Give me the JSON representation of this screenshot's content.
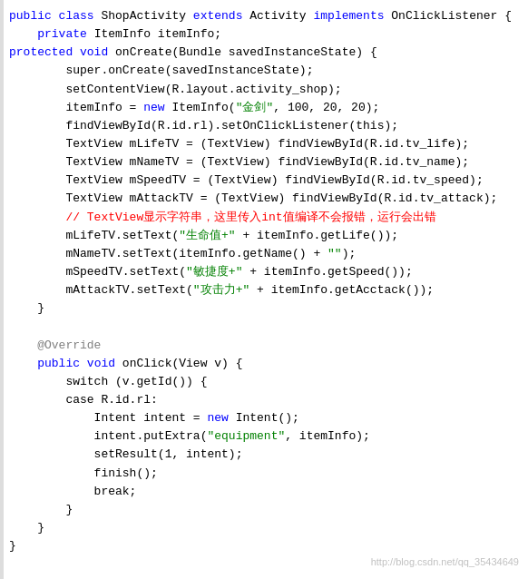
{
  "code": {
    "lines": [
      {
        "tokens": [
          {
            "text": "public class ",
            "style": "kw"
          },
          {
            "text": "ShopActivity ",
            "style": "id"
          },
          {
            "text": "extends ",
            "style": "kw"
          },
          {
            "text": "Activity ",
            "style": "id"
          },
          {
            "text": "implements ",
            "style": "kw"
          },
          {
            "text": "OnClickListener {",
            "style": "id"
          }
        ]
      },
      {
        "tokens": [
          {
            "text": "    private ",
            "style": "kw"
          },
          {
            "text": "ItemInfo itemInfo;",
            "style": "id"
          }
        ]
      },
      {
        "tokens": [
          {
            "text": "protected ",
            "style": "kw"
          },
          {
            "text": "void ",
            "style": "kw"
          },
          {
            "text": "onCreate(Bundle savedInstanceState) {",
            "style": "id"
          }
        ]
      },
      {
        "tokens": [
          {
            "text": "        super.onCreate(savedInstanceState);",
            "style": "normal"
          }
        ]
      },
      {
        "tokens": [
          {
            "text": "        setContentView(R.layout.activity_shop);",
            "style": "normal"
          }
        ]
      },
      {
        "tokens": [
          {
            "text": "        itemInfo = ",
            "style": "normal"
          },
          {
            "text": "new ",
            "style": "kw"
          },
          {
            "text": "ItemInfo(",
            "style": "normal"
          },
          {
            "text": "\"金剑\"",
            "style": "string"
          },
          {
            "text": ", 100, 20, 20);",
            "style": "normal"
          }
        ]
      },
      {
        "tokens": [
          {
            "text": "        findViewById(R.id.rl).setOnClickListener(this);",
            "style": "normal"
          }
        ]
      },
      {
        "tokens": [
          {
            "text": "        TextView mLifeTV = (TextView) findViewById(R.id.tv_life);",
            "style": "normal"
          }
        ]
      },
      {
        "tokens": [
          {
            "text": "        TextView mNameTV = (TextView) findViewById(R.id.tv_name);",
            "style": "normal"
          }
        ]
      },
      {
        "tokens": [
          {
            "text": "        TextView mSpeedTV = (TextView) findViewById(R.id.tv_speed);",
            "style": "normal"
          }
        ]
      },
      {
        "tokens": [
          {
            "text": "        TextView mAttackTV = (TextView) findViewById(R.id.tv_attack);",
            "style": "normal"
          }
        ]
      },
      {
        "tokens": [
          {
            "text": "        // TextView显示字符串，这里传入int值编译不会报错，运行会出错",
            "style": "comment"
          }
        ]
      },
      {
        "tokens": [
          {
            "text": "        mLifeTV.setText(",
            "style": "normal"
          },
          {
            "text": "\"生命值+\"",
            "style": "string"
          },
          {
            "text": " + itemInfo.getLife());",
            "style": "normal"
          }
        ]
      },
      {
        "tokens": [
          {
            "text": "        mNameTV.setText(itemInfo.getName() + ",
            "style": "normal"
          },
          {
            "text": "\"\"",
            "style": "string"
          },
          {
            "text": ");",
            "style": "normal"
          }
        ]
      },
      {
        "tokens": [
          {
            "text": "        mSpeedTV.setText(",
            "style": "normal"
          },
          {
            "text": "\"敏捷度+\"",
            "style": "string"
          },
          {
            "text": " + itemInfo.getSpeed());",
            "style": "normal"
          }
        ]
      },
      {
        "tokens": [
          {
            "text": "        mAttackTV.setText(",
            "style": "normal"
          },
          {
            "text": "\"攻击力+\"",
            "style": "string"
          },
          {
            "text": " + itemInfo.getAcctack());",
            "style": "normal"
          }
        ]
      },
      {
        "tokens": [
          {
            "text": "    }",
            "style": "normal"
          }
        ]
      },
      {
        "tokens": [
          {
            "text": "",
            "style": "normal"
          }
        ]
      },
      {
        "tokens": [
          {
            "text": "    @Override",
            "style": "annotation"
          }
        ]
      },
      {
        "tokens": [
          {
            "text": "    public ",
            "style": "kw"
          },
          {
            "text": "void ",
            "style": "kw"
          },
          {
            "text": "onClick(View v) {",
            "style": "normal"
          }
        ]
      },
      {
        "tokens": [
          {
            "text": "        switch (v.getId()) {",
            "style": "normal"
          }
        ]
      },
      {
        "tokens": [
          {
            "text": "        case R.id.rl:",
            "style": "normal"
          }
        ]
      },
      {
        "tokens": [
          {
            "text": "            Intent intent = ",
            "style": "normal"
          },
          {
            "text": "new ",
            "style": "kw"
          },
          {
            "text": "Intent();",
            "style": "normal"
          }
        ]
      },
      {
        "tokens": [
          {
            "text": "            intent.putExtra(",
            "style": "normal"
          },
          {
            "text": "\"equipment\"",
            "style": "string"
          },
          {
            "text": ", itemInfo);",
            "style": "normal"
          }
        ]
      },
      {
        "tokens": [
          {
            "text": "            setResult(1, intent);",
            "style": "normal"
          }
        ]
      },
      {
        "tokens": [
          {
            "text": "            finish();",
            "style": "normal"
          }
        ]
      },
      {
        "tokens": [
          {
            "text": "            break;",
            "style": "normal"
          }
        ]
      },
      {
        "tokens": [
          {
            "text": "        }",
            "style": "normal"
          }
        ]
      },
      {
        "tokens": [
          {
            "text": "    }",
            "style": "normal"
          }
        ]
      },
      {
        "tokens": [
          {
            "text": "}",
            "style": "normal"
          }
        ]
      }
    ],
    "watermark": "http://blog.csdn.net/qq_35434649"
  }
}
